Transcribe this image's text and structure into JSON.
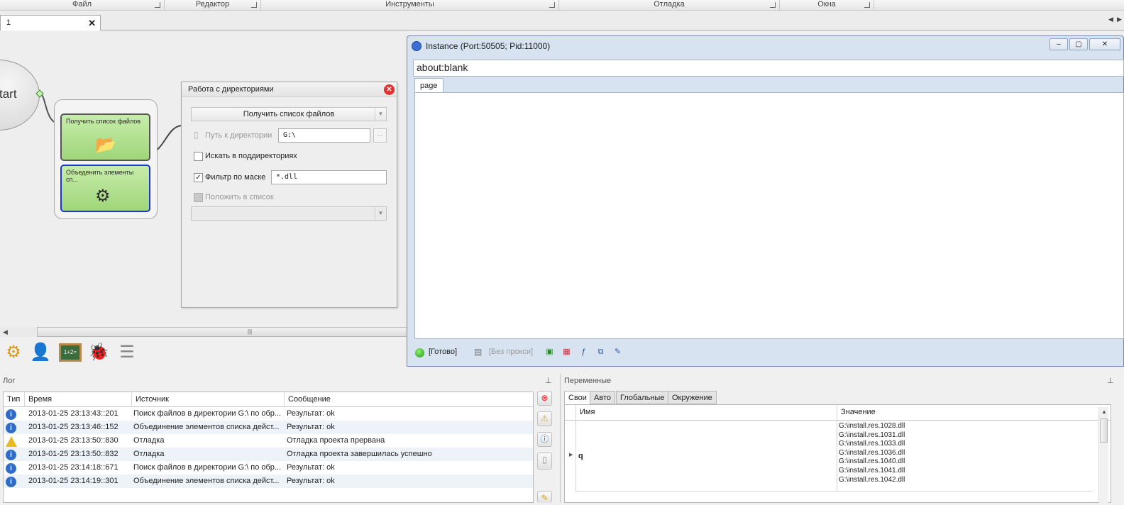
{
  "ribbon": {
    "groups": [
      "Файл",
      "Редактор",
      "Инструменты",
      "Отладка",
      "Окна"
    ]
  },
  "doc_tab": {
    "label": "1"
  },
  "canvas": {
    "start_label": "tart",
    "node1_label": "Получить список файлов",
    "node2_label": "Объеденить элементы сп..."
  },
  "config": {
    "title": "Работа с директориями",
    "action_value": "Получить список файлов",
    "path_label": "Путь к директории",
    "path_value": "G:\\",
    "path_browse": "...",
    "subdirs_label": "Искать в поддиректориях",
    "filter_label": "Фильтр по маске",
    "filter_value": "*.dll",
    "tolist_label": "Положить в список"
  },
  "instance": {
    "title": "Instance (Port:50505; Pid:11000)",
    "address": "about:blank",
    "page_tab": "page",
    "status_ready": "[Готово]",
    "status_proxy": "[Без прокси]"
  },
  "log": {
    "header": "Лог",
    "columns": [
      "Тип",
      "Время",
      "Источник",
      "Сообщение"
    ],
    "rows": [
      {
        "type": "info",
        "time": "2013-01-25   23:13:43::201",
        "source": "Поиск файлов в директории G:\\ по обр...",
        "message": "Результат: ok"
      },
      {
        "type": "info",
        "time": "2013-01-25   23:13:46::152",
        "source": "Объединение элементов списка дейст...",
        "message": "Результат: ok"
      },
      {
        "type": "warning",
        "time": "2013-01-25   23:13:50::830",
        "source": "Отладка",
        "message": "Отладка проекта прервана"
      },
      {
        "type": "info",
        "time": "2013-01-25   23:13:50::832",
        "source": "Отладка",
        "message": "Отладка проекта завершилась успешно"
      },
      {
        "type": "info",
        "time": "2013-01-25   23:14:18::671",
        "source": "Поиск файлов в директории G:\\ по обр...",
        "message": "Результат: ok"
      },
      {
        "type": "info",
        "time": "2013-01-25   23:14:19::301",
        "source": "Объединение элементов списка дейст...",
        "message": "Результат: ok"
      }
    ]
  },
  "variables": {
    "header": "Переменные",
    "tabs": [
      "Свои",
      "Авто",
      "Глобальные",
      "Окружение"
    ],
    "columns": [
      "Имя",
      "Значение"
    ],
    "row_name": "q",
    "row_values": [
      "G:\\install.res.1028.dll",
      "G:\\install.res.1031.dll",
      "G:\\install.res.1033.dll",
      "G:\\install.res.1036.dll",
      "G:\\install.res.1040.dll",
      "G:\\install.res.1041.dll",
      "G:\\install.res.1042.dll"
    ]
  },
  "colors": {
    "node_green": "#9fd67a",
    "selected_border": "#1a37d6",
    "error_red": "#e03030"
  }
}
